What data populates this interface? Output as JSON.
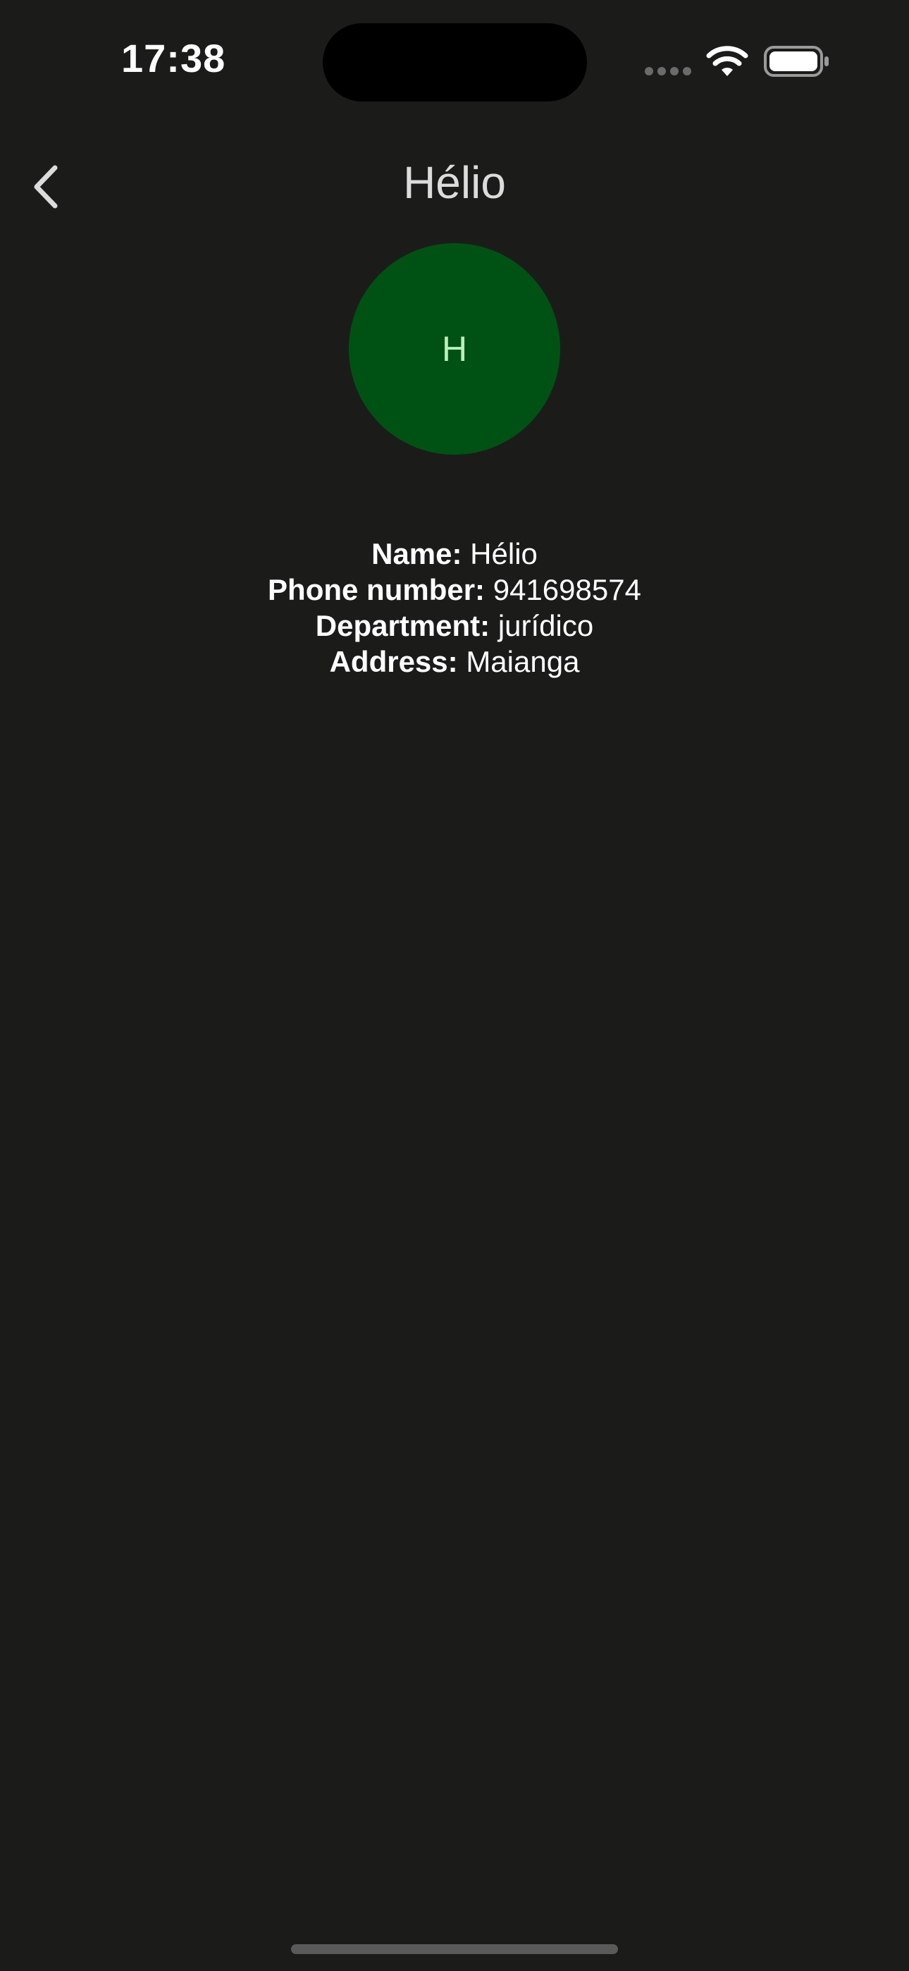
{
  "status_bar": {
    "time": "17:38"
  },
  "nav": {
    "title": "Hélio",
    "back_icon": "chevron-left-icon"
  },
  "avatar": {
    "initial": "H",
    "background_color": "#005214",
    "text_color": "#b9efb9"
  },
  "details": {
    "name_label": "Name:",
    "name_value": "Hélio",
    "phone_label": "Phone number:",
    "phone_value": "941698574",
    "department_label": "Department:",
    "department_value": "jurídico",
    "address_label": "Address:",
    "address_value": "Maianga"
  },
  "theme": {
    "background": "#1b1c1a",
    "text": "#ffffff",
    "title_text": "#dcdcdc"
  }
}
